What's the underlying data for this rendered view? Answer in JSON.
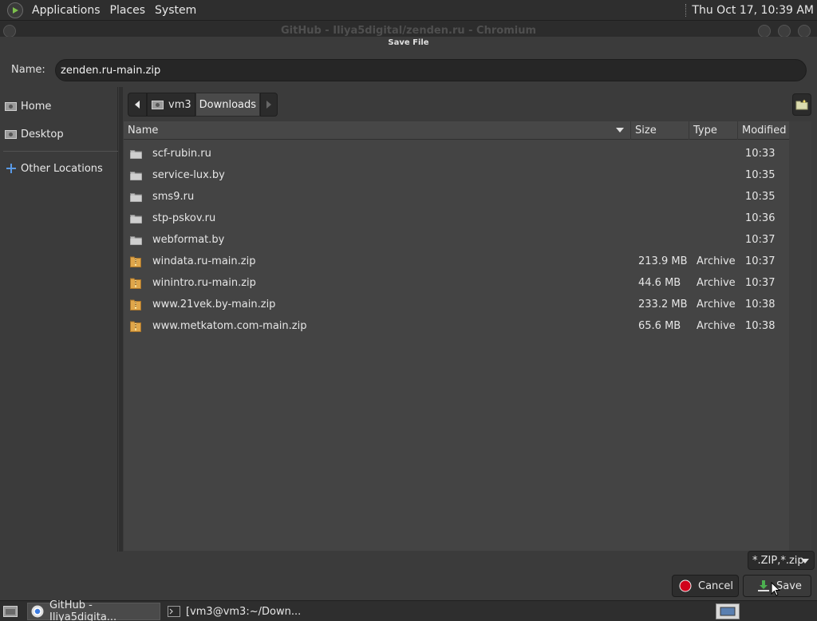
{
  "top_panel": {
    "menus": [
      "Applications",
      "Places",
      "System"
    ],
    "clock": "Thu Oct 17, 10:39 AM"
  },
  "window": {
    "title": "GitHub - Iliya5digital/zenden.ru - Chromium"
  },
  "dialog": {
    "title": "Save File",
    "name_label": "Name:",
    "name_value": "zenden.ru-main.zip"
  },
  "sidebar": {
    "items": [
      {
        "label": "Home",
        "icon": "home-icon"
      },
      {
        "label": "Desktop",
        "icon": "desktop-icon"
      },
      {
        "label": "Other Locations",
        "icon": "plus-icon"
      }
    ]
  },
  "pathbar": {
    "segments": [
      "vm3",
      "Downloads"
    ],
    "active": "Downloads"
  },
  "columns": {
    "name": "Name",
    "size": "Size",
    "type": "Type",
    "modified": "Modified"
  },
  "files": [
    {
      "name": "scf-rubin.ru",
      "size": "",
      "type": "",
      "modified": "10:33",
      "kind": "folder"
    },
    {
      "name": "service-lux.by",
      "size": "",
      "type": "",
      "modified": "10:35",
      "kind": "folder"
    },
    {
      "name": "sms9.ru",
      "size": "",
      "type": "",
      "modified": "10:35",
      "kind": "folder"
    },
    {
      "name": "stp-pskov.ru",
      "size": "",
      "type": "",
      "modified": "10:36",
      "kind": "folder"
    },
    {
      "name": "webformat.by",
      "size": "",
      "type": "",
      "modified": "10:37",
      "kind": "folder"
    },
    {
      "name": "windata.ru-main.zip",
      "size": "213.9 MB",
      "type": "Archive",
      "modified": "10:37",
      "kind": "archive"
    },
    {
      "name": "winintro.ru-main.zip",
      "size": "44.6 MB",
      "type": "Archive",
      "modified": "10:37",
      "kind": "archive"
    },
    {
      "name": "www.21vek.by-main.zip",
      "size": "233.2 MB",
      "type": "Archive",
      "modified": "10:38",
      "kind": "archive"
    },
    {
      "name": "www.metkatom.com-main.zip",
      "size": "65.6 MB",
      "type": "Archive",
      "modified": "10:38",
      "kind": "archive"
    }
  ],
  "filter": {
    "value": "*.ZIP,*.zip"
  },
  "buttons": {
    "cancel": "Cancel",
    "save": "Save"
  },
  "taskbar": {
    "items": [
      {
        "label": "GitHub - Iliya5digita...",
        "icon": "chromium-icon"
      },
      {
        "label": "[vm3@vm3:~/Down...",
        "icon": "terminal-icon"
      }
    ]
  },
  "colors": {
    "folder": "#bdbdbd",
    "archive": "#e0a64a",
    "cancel_red": "#d0021b",
    "save_green": "#4caf50"
  }
}
